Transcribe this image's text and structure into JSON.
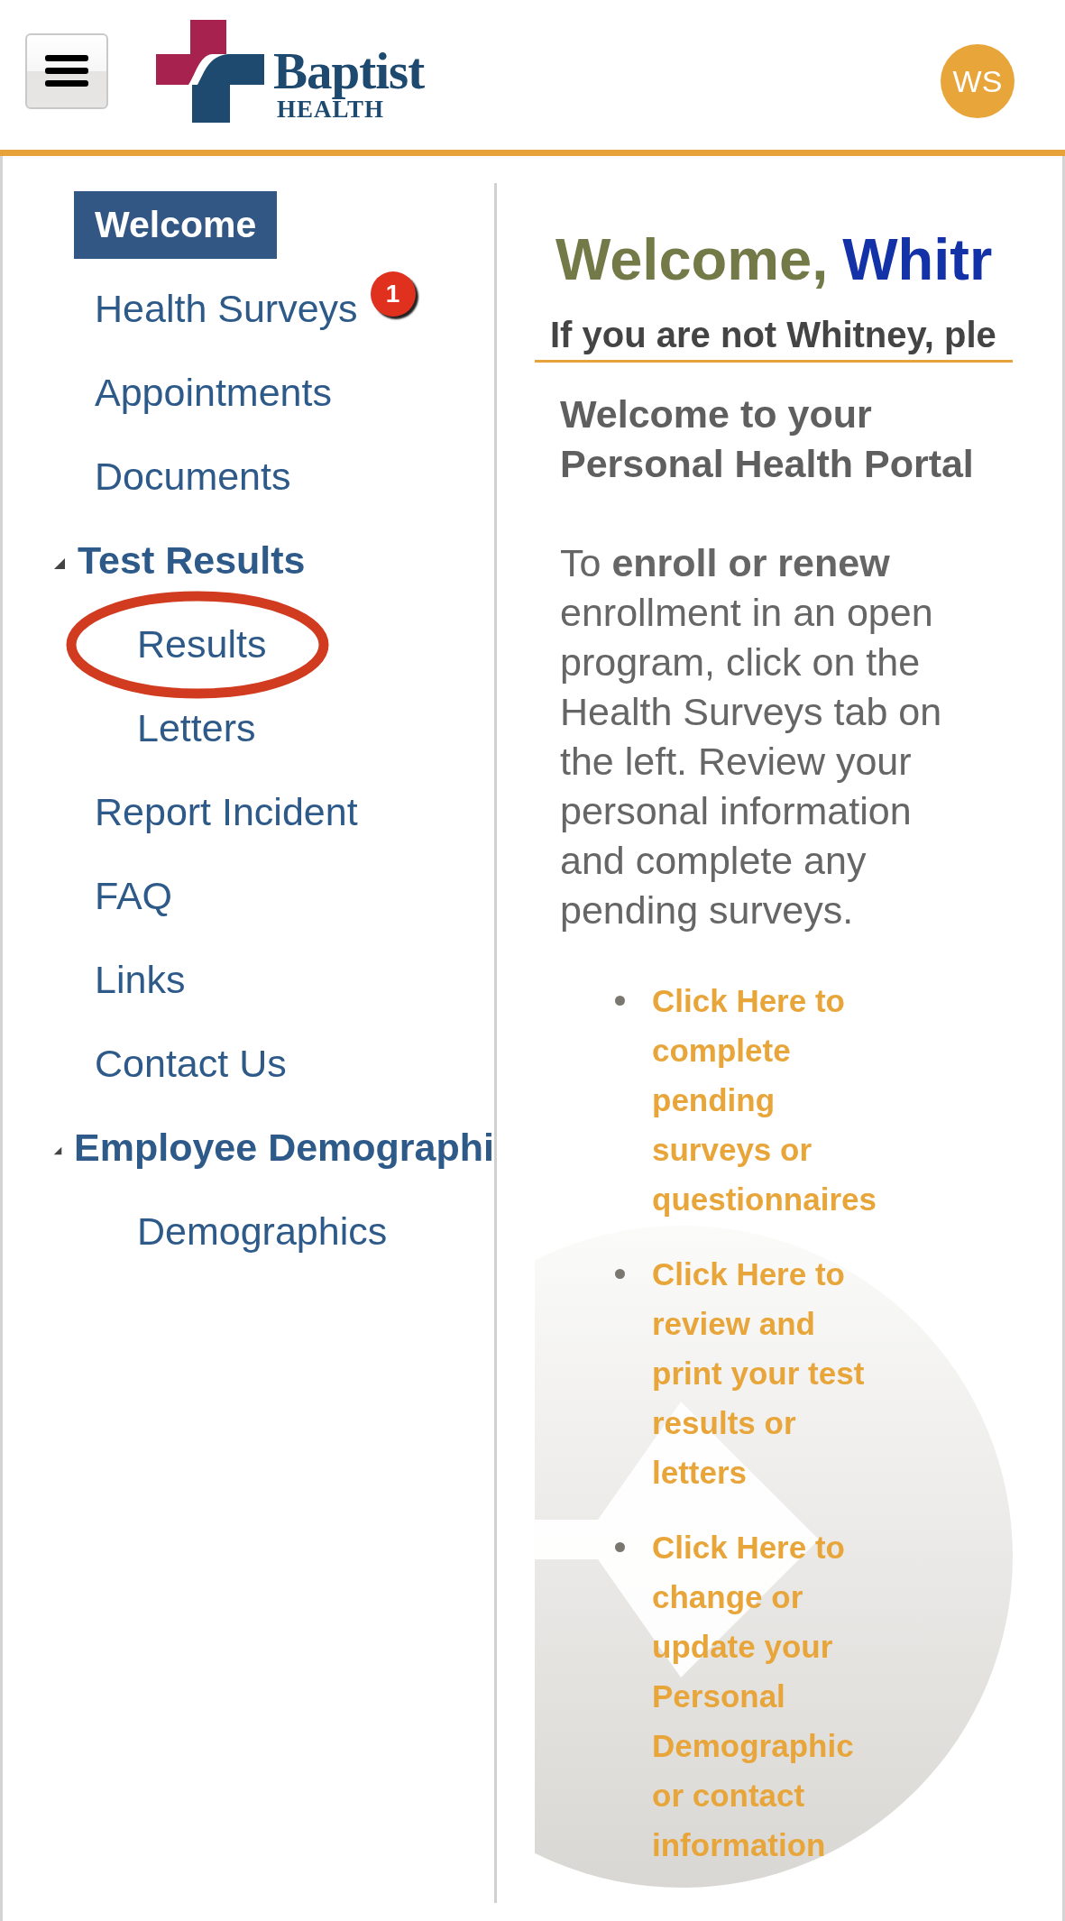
{
  "header": {
    "logo": {
      "line1": "Baptist",
      "line2": "HEALTH"
    },
    "avatar": "WS"
  },
  "nav": [
    {
      "kind": "link",
      "label": "Welcome",
      "selected": true
    },
    {
      "kind": "link",
      "label": "Health Surveys",
      "selected": false,
      "badge": "1"
    },
    {
      "kind": "link",
      "label": "Appointments",
      "selected": false
    },
    {
      "kind": "link",
      "label": "Documents",
      "selected": false
    },
    {
      "kind": "group",
      "label": "Test Results",
      "expanded": true,
      "children": [
        {
          "label": "Results",
          "selected": false,
          "circled": true
        },
        {
          "label": "Letters",
          "selected": false,
          "circled": false
        }
      ]
    },
    {
      "kind": "link",
      "label": "Report Incident",
      "selected": false
    },
    {
      "kind": "link",
      "label": "FAQ",
      "selected": false
    },
    {
      "kind": "link",
      "label": "Links",
      "selected": false
    },
    {
      "kind": "link",
      "label": "Contact Us",
      "selected": false
    },
    {
      "kind": "group",
      "label": "Employee Demographi",
      "expanded": true,
      "children": [
        {
          "label": "Demographics",
          "selected": false,
          "circled": false
        }
      ]
    }
  ],
  "content": {
    "greeting": "Welcome,",
    "name": "Whitr",
    "notice": "If you are not Whitney, ple",
    "intro_lines": [
      "Welcome to your",
      "Personal Health Portal"
    ],
    "body_lines": [
      "To **enroll or renew**",
      "enrollment in an open",
      "program, click on the",
      "Health Surveys tab on",
      "the left. Review your",
      "personal information",
      "and complete any",
      "pending surveys."
    ],
    "links": [
      {
        "lines": [
          "Click Here to",
          "complete",
          "pending",
          "surveys or",
          "questionnaires"
        ]
      },
      {
        "lines": [
          "Click Here to",
          "review and",
          "print your test",
          "results or",
          "letters"
        ]
      },
      {
        "lines": [
          "Click Here to",
          "change or",
          "update your",
          "Personal",
          "Demographic",
          "or contact",
          "information"
        ]
      }
    ]
  }
}
